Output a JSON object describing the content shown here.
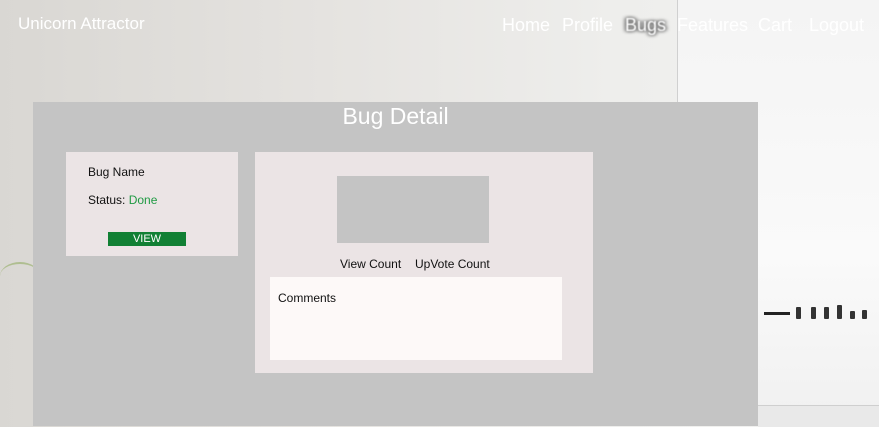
{
  "navbar": {
    "brand": "Unicorn Attractor",
    "links": [
      "Home",
      "Profile",
      "Bugs",
      "Features",
      "Cart",
      "Logout"
    ]
  },
  "page": {
    "title": "Bug Detail"
  },
  "bug": {
    "name": "Bug Name",
    "status_label": "Status:",
    "status_value": "Done",
    "view_button": "VIEW",
    "view_count_label": "View Count",
    "upvote_count_label": "UpVote Count",
    "comments_label": "Comments"
  },
  "colors": {
    "panel": "#c4c4c4",
    "card": "#ebe4e5",
    "status_done": "#1f9a43",
    "view_button": "#118034"
  }
}
